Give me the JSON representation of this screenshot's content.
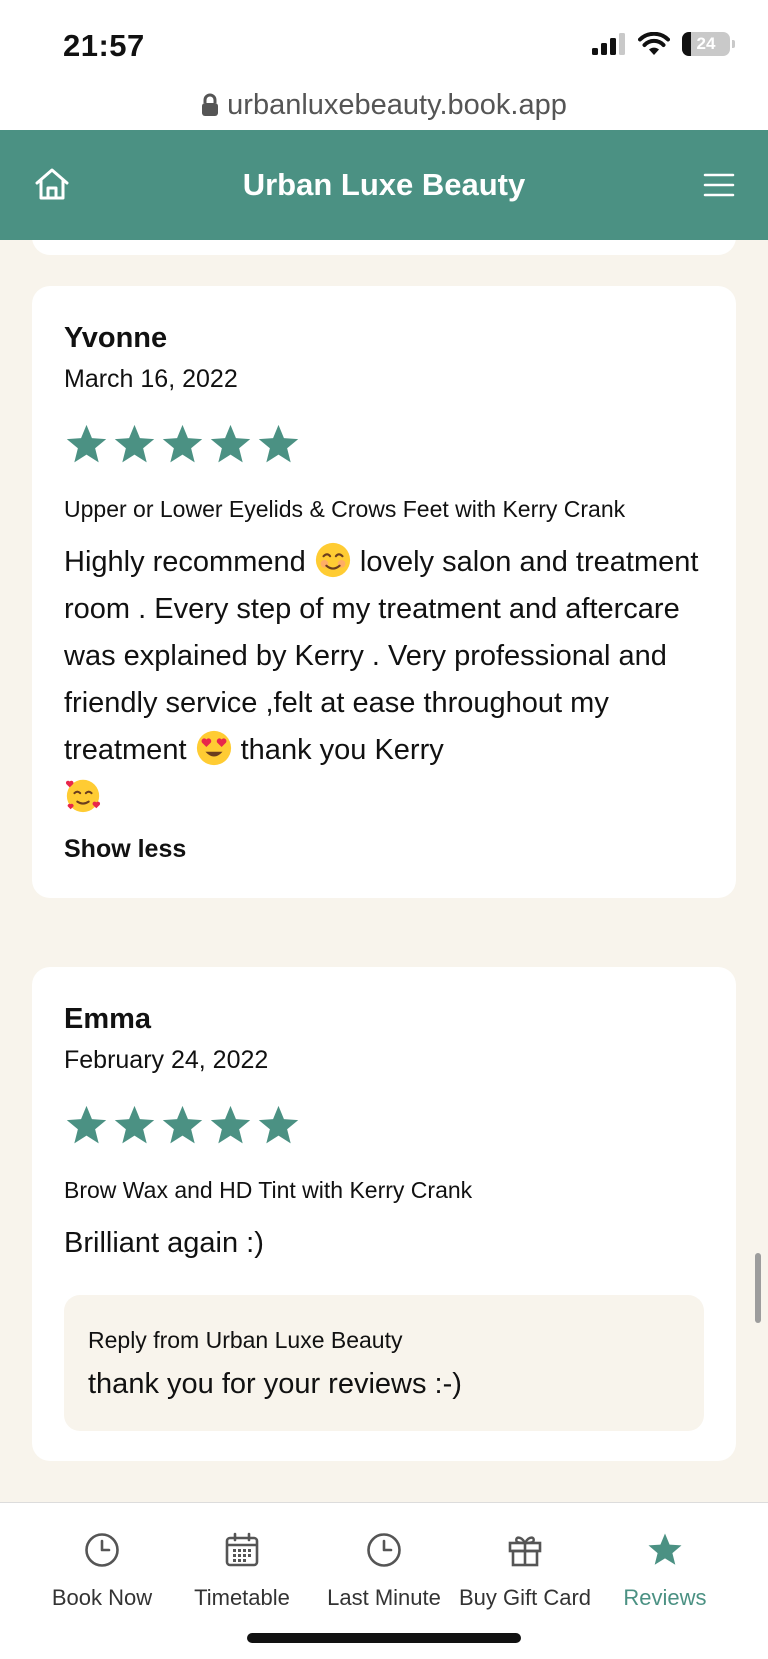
{
  "status": {
    "time": "21:57",
    "battery": "24"
  },
  "browser": {
    "url": "urbanluxebeauty.book.app"
  },
  "header": {
    "title": "Urban Luxe Beauty"
  },
  "reviews": [
    {
      "name": "Yvonne",
      "date": "March 16, 2022",
      "rating": 5,
      "service": "Upper or Lower Eyelids & Crows Feet with Kerry Crank",
      "text_part1": "Highly recommend",
      "text_part2": "lovely salon and treatment room . Every step of my treatment and aftercare was explained by Kerry . Very professional and friendly service ,felt at ease throughout my treatment",
      "text_part3": "thank you Kerry",
      "toggle_label": "Show less"
    },
    {
      "name": "Emma",
      "date": "February 24, 2022",
      "rating": 5,
      "service": "Brow Wax and HD Tint with Kerry Crank",
      "text": "Brilliant again :)",
      "reply_label": "Reply from Urban Luxe Beauty",
      "reply_text": "thank you for your reviews :-)"
    }
  ],
  "nav": {
    "items": [
      {
        "label": "Book Now",
        "icon": "clock-icon"
      },
      {
        "label": "Timetable",
        "icon": "calendar-icon"
      },
      {
        "label": "Last Minute",
        "icon": "clock-icon"
      },
      {
        "label": "Buy Gift Card",
        "icon": "gift-icon"
      },
      {
        "label": "Reviews",
        "icon": "star-icon",
        "active": true
      }
    ]
  },
  "colors": {
    "brand": "#4b9183",
    "background": "#f8f4ec"
  }
}
